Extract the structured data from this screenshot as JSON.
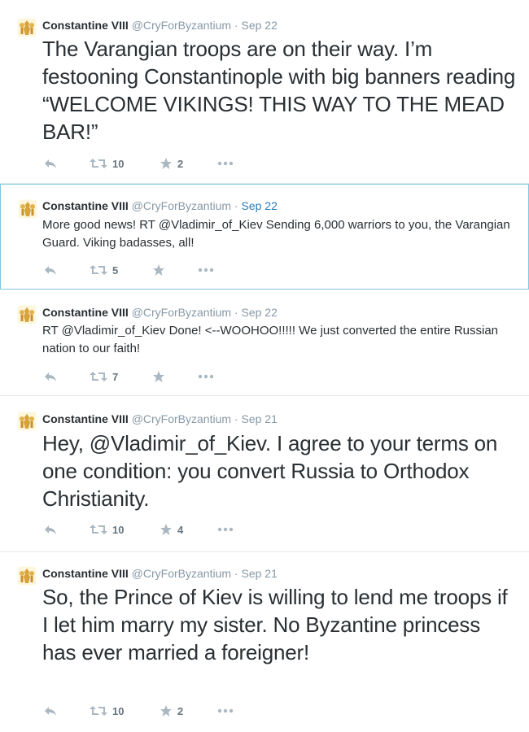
{
  "colors": {
    "text": "#292f33",
    "muted": "#8899a6",
    "link": "#2b7bb9",
    "divider": "#e1e8ed",
    "selected_border": "#7fc8e4"
  },
  "tweets": [
    {
      "name": "Constantine VIII",
      "handle": "@CryForByzantium",
      "sep": "·",
      "date": "Sep 22",
      "text": "The Varangian troops are on their way. I’m festooning Constantinople with big banners reading “WELCOME VIKINGS! THIS WAY TO THE MEAD BAR!”",
      "retweets": "10",
      "favorites": "2"
    },
    {
      "name": "Constantine VIII",
      "handle": "@CryForByzantium",
      "sep": "·",
      "date": "Sep 22",
      "text": "More good news! RT @Vladimir_of_Kiev Sending 6,000 warriors to you, the Varangian Guard. Viking badasses, all!",
      "retweets": "5",
      "favorites": ""
    },
    {
      "name": "Constantine VIII",
      "handle": "@CryForByzantium",
      "sep": "·",
      "date": "Sep 22",
      "text": "RT @Vladimir_of_Kiev Done! <--WOOHOO!!!!! We just converted the entire Russian nation to our faith!",
      "retweets": "7",
      "favorites": ""
    },
    {
      "name": "Constantine VIII",
      "handle": "@CryForByzantium",
      "sep": "·",
      "date": "Sep 21",
      "text": "Hey, @Vladimir_of_Kiev. I agree to your terms on one condition: you convert Russia to Orthodox Christianity.",
      "retweets": "10",
      "favorites": "4"
    },
    {
      "name": "Constantine VIII",
      "handle": "@CryForByzantium",
      "sep": "·",
      "date": "Sep 21",
      "text": "So, the Prince of Kiev is willing to lend me troops if I let him marry my sister. No Byzantine princess has ever married a foreigner!",
      "retweets": "10",
      "favorites": "2"
    }
  ]
}
